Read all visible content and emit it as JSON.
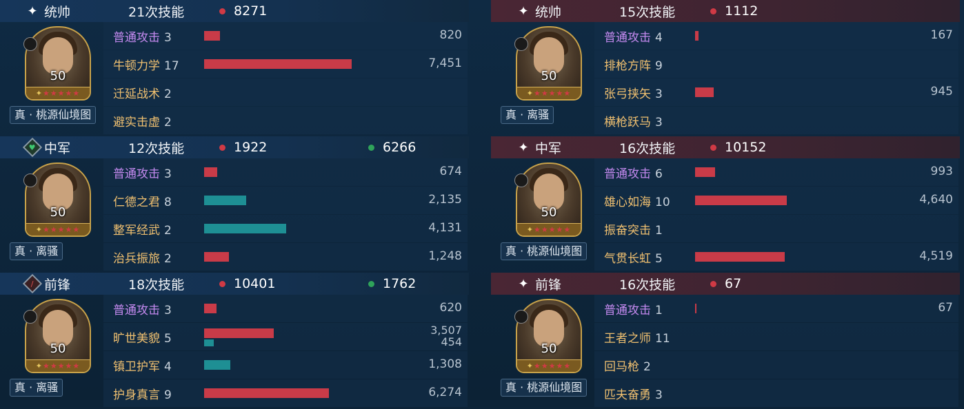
{
  "left": [
    {
      "role": "统帅",
      "icon": "star-icon",
      "skill_count": "21次技能",
      "damage": "8271",
      "heal": "",
      "level": "50",
      "tag": "真 · 桃源仙境图",
      "skills": [
        {
          "name": "普通攻击",
          "count": "3",
          "basic": true,
          "red": 0.026,
          "teal": 0,
          "value": "820",
          "value2": ""
        },
        {
          "name": "牛顿力学",
          "count": "17",
          "basic": false,
          "red": 0.238,
          "teal": 0,
          "value": "7,451",
          "value2": ""
        },
        {
          "name": "迁延战术",
          "count": "2",
          "basic": false,
          "red": 0,
          "teal": 0,
          "value": "",
          "value2": ""
        },
        {
          "name": "避实击虚",
          "count": "2",
          "basic": false,
          "red": 0,
          "teal": 0,
          "value": "",
          "value2": ""
        }
      ]
    },
    {
      "role": "中军",
      "icon": "heart-diamond-icon",
      "skill_count": "12次技能",
      "damage": "1922",
      "heal": "6266",
      "level": "50",
      "tag": "真 · 离骚",
      "skills": [
        {
          "name": "普通攻击",
          "count": "3",
          "basic": true,
          "red": 0.021,
          "teal": 0,
          "value": "674",
          "value2": ""
        },
        {
          "name": "仁德之君",
          "count": "8",
          "basic": false,
          "red": 0,
          "teal": 0.068,
          "value": "2,135",
          "value2": ""
        },
        {
          "name": "整军经武",
          "count": "2",
          "basic": false,
          "red": 0,
          "teal": 0.132,
          "value": "4,131",
          "value2": ""
        },
        {
          "name": "治兵振旅",
          "count": "2",
          "basic": false,
          "red": 0.04,
          "teal": 0,
          "value": "1,248",
          "value2": ""
        }
      ]
    },
    {
      "role": "前锋",
      "icon": "sword-diamond-icon",
      "skill_count": "18次技能",
      "damage": "10401",
      "heal": "1762",
      "level": "50",
      "tag": "真 · 离骚",
      "skills": [
        {
          "name": "普通攻击",
          "count": "3",
          "basic": true,
          "red": 0.02,
          "teal": 0,
          "value": "620",
          "value2": ""
        },
        {
          "name": "旷世美貌",
          "count": "5",
          "basic": false,
          "red": 0.112,
          "teal": 0.015,
          "value": "3,507",
          "value2": "454"
        },
        {
          "name": "镇卫护军",
          "count": "4",
          "basic": false,
          "red": 0,
          "teal": 0.042,
          "value": "1,308",
          "value2": ""
        },
        {
          "name": "护身真言",
          "count": "9",
          "basic": false,
          "red": 0.201,
          "teal": 0,
          "value": "6,274",
          "value2": ""
        }
      ]
    }
  ],
  "right": [
    {
      "role": "统帅",
      "icon": "star-icon",
      "skill_count": "15次技能",
      "damage": "1112",
      "heal": "",
      "level": "50",
      "tag": "真 · 离骚",
      "skills": [
        {
          "name": "普通攻击",
          "count": "4",
          "basic": true,
          "red": 0.005,
          "teal": 0,
          "value": "167",
          "value2": ""
        },
        {
          "name": "排枪方阵",
          "count": "9",
          "basic": false,
          "red": 0,
          "teal": 0,
          "value": "",
          "value2": ""
        },
        {
          "name": "张弓挟矢",
          "count": "3",
          "basic": false,
          "red": 0.03,
          "teal": 0,
          "value": "945",
          "value2": ""
        },
        {
          "name": "横枪跃马",
          "count": "3",
          "basic": false,
          "red": 0,
          "teal": 0,
          "value": "",
          "value2": ""
        }
      ]
    },
    {
      "role": "中军",
      "icon": "star-icon",
      "skill_count": "16次技能",
      "damage": "10152",
      "heal": "",
      "level": "50",
      "tag": "真 · 桃源仙境图",
      "skills": [
        {
          "name": "普通攻击",
          "count": "6",
          "basic": true,
          "red": 0.032,
          "teal": 0,
          "value": "993",
          "value2": ""
        },
        {
          "name": "雄心如海",
          "count": "10",
          "basic": false,
          "red": 0.148,
          "teal": 0,
          "value": "4,640",
          "value2": ""
        },
        {
          "name": "振奋突击",
          "count": "1",
          "basic": false,
          "red": 0,
          "teal": 0,
          "value": "",
          "value2": ""
        },
        {
          "name": "气贯长虹",
          "count": "5",
          "basic": false,
          "red": 0.144,
          "teal": 0,
          "value": "4,519",
          "value2": ""
        }
      ]
    },
    {
      "role": "前锋",
      "icon": "star-icon",
      "skill_count": "16次技能",
      "damage": "67",
      "heal": "",
      "level": "50",
      "tag": "真 · 桃源仙境图",
      "skills": [
        {
          "name": "普通攻击",
          "count": "1",
          "basic": true,
          "red": 0.002,
          "teal": 0,
          "value": "67",
          "value2": ""
        },
        {
          "name": "王者之师",
          "count": "11",
          "basic": false,
          "red": 0,
          "teal": 0,
          "value": "",
          "value2": ""
        },
        {
          "name": "回马枪",
          "count": "2",
          "basic": false,
          "red": 0,
          "teal": 0,
          "value": "",
          "value2": ""
        },
        {
          "name": "匹夫奋勇",
          "count": "3",
          "basic": false,
          "red": 0,
          "teal": 0,
          "value": "",
          "value2": ""
        }
      ]
    }
  ],
  "colors": {
    "damage": "#d03a45",
    "heal": "#2fa35a",
    "bar_red": "#c93b48",
    "bar_teal": "#1e8f94",
    "basic_skill": "#c58af0",
    "skill": "#f0c070"
  }
}
